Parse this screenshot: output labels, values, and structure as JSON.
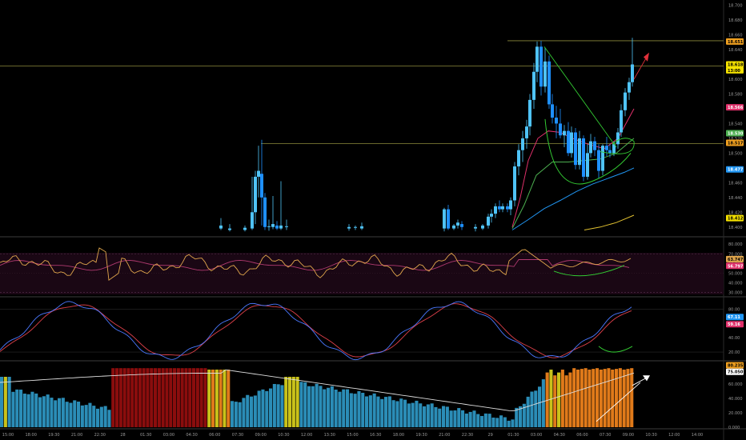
{
  "colors": {
    "background": "#000000",
    "candle": "#1e90ff",
    "candle_light": "#4fc3f7",
    "grid_line": "#262626",
    "pane_separator": "#3c3c3c",
    "hline": "#8c8a3c",
    "rsi_band": "#1a0714",
    "rsi_line": "#e0a64c",
    "rsi_ma": "#b03a6f",
    "stoch_k": "#4a78ff",
    "stoch_d": "#e0404a",
    "annot_green": "#33cc33",
    "arrow_red": "#e0303a",
    "vol_blue": "#2b8db7",
    "vol_red": "#8b0d0d",
    "vol_orange": "#e07a1a",
    "vol_yellow": "#c9c21a",
    "vol_ma": "#dddddd"
  },
  "chart_data": [
    {
      "type": "candlestick",
      "pane": "price",
      "y_ticks": [
        "18.700",
        "18.680",
        "18.660",
        "18.640",
        "18.620",
        "18.600",
        "18.580",
        "18.560",
        "18.540",
        "18.520",
        "18.500",
        "18.480",
        "18.460",
        "18.440",
        "18.420",
        "18.400"
      ],
      "ylim": [
        18.39,
        18.705
      ],
      "horizontal_levels": [
        18.652,
        18.618,
        18.513
      ],
      "price_badges": [
        {
          "text": "18.651",
          "value": 18.651,
          "color": "#f0a020",
          "text_color": "#000000"
        },
        {
          "text": "18.618",
          "value": 18.62,
          "color": "#f4e100",
          "text_color": "#000000"
        },
        {
          "text": "13:00",
          "value": 18.612,
          "color": "#f4e100",
          "text_color": "#000000"
        },
        {
          "text": "18.566",
          "value": 18.562,
          "color": "#e0306a",
          "text_color": "#ffffff"
        },
        {
          "text": "18.530",
          "value": 18.527,
          "color": "#4caf50",
          "text_color": "#ffffff"
        },
        {
          "text": "18.517",
          "value": 18.514,
          "color": "#f0a020",
          "text_color": "#000000"
        },
        {
          "text": "18.477",
          "value": 18.478,
          "color": "#2196f3",
          "text_color": "#ffffff"
        },
        {
          "text": "18.412",
          "value": 18.412,
          "color": "#f4e100",
          "text_color": "#000000"
        }
      ]
    },
    {
      "type": "line",
      "pane": "rsi",
      "y_ticks": [
        "80.000",
        "70.000",
        "60.000",
        "50.000",
        "40.000",
        "30.000"
      ],
      "ylim": [
        27,
        86
      ],
      "band": [
        30,
        70
      ],
      "price_badges": [
        {
          "text": "63.747",
          "value": 64.5,
          "color": "#e0a64c",
          "text_color": "#000000"
        },
        {
          "text": "56.797",
          "value": 57.5,
          "color": "#e0306a",
          "text_color": "#ffffff"
        }
      ]
    },
    {
      "type": "line",
      "pane": "stoch",
      "y_ticks": [
        "80.00",
        "60.00",
        "40.00",
        "20.00"
      ],
      "ylim": [
        10,
        95
      ],
      "price_badges": [
        {
          "text": "67.11",
          "value": 69,
          "color": "#2196f3",
          "text_color": "#ffffff"
        },
        {
          "text": "59.16",
          "value": 59,
          "color": "#e0306a",
          "text_color": "#ffffff"
        }
      ]
    },
    {
      "type": "bar",
      "pane": "volume",
      "y_ticks": [
        "60.000",
        "40.000",
        "20.000",
        "0.000"
      ],
      "ylim": [
        0,
        90
      ],
      "price_badges": [
        {
          "text": "80.235",
          "value": 86,
          "color": "#f0a020",
          "text_color": "#000000"
        },
        {
          "text": "75.050",
          "value": 77,
          "color": "#ffffff",
          "text_color": "#000000"
        }
      ]
    }
  ],
  "time_axis": {
    "labels": [
      "15:00",
      "18:00",
      "19:30",
      "21:00",
      "22:30",
      "28",
      "01:30",
      "03:00",
      "04:30",
      "06:00",
      "07:30",
      "09:00",
      "10:30",
      "12:00",
      "13:30",
      "15:00",
      "16:30",
      "18:00",
      "19:30",
      "21:00",
      "22:30",
      "29",
      "01:30",
      "03:00",
      "04:30",
      "06:00",
      "07:30",
      "09:00",
      "10:30",
      "12:00",
      "14:00"
    ]
  }
}
